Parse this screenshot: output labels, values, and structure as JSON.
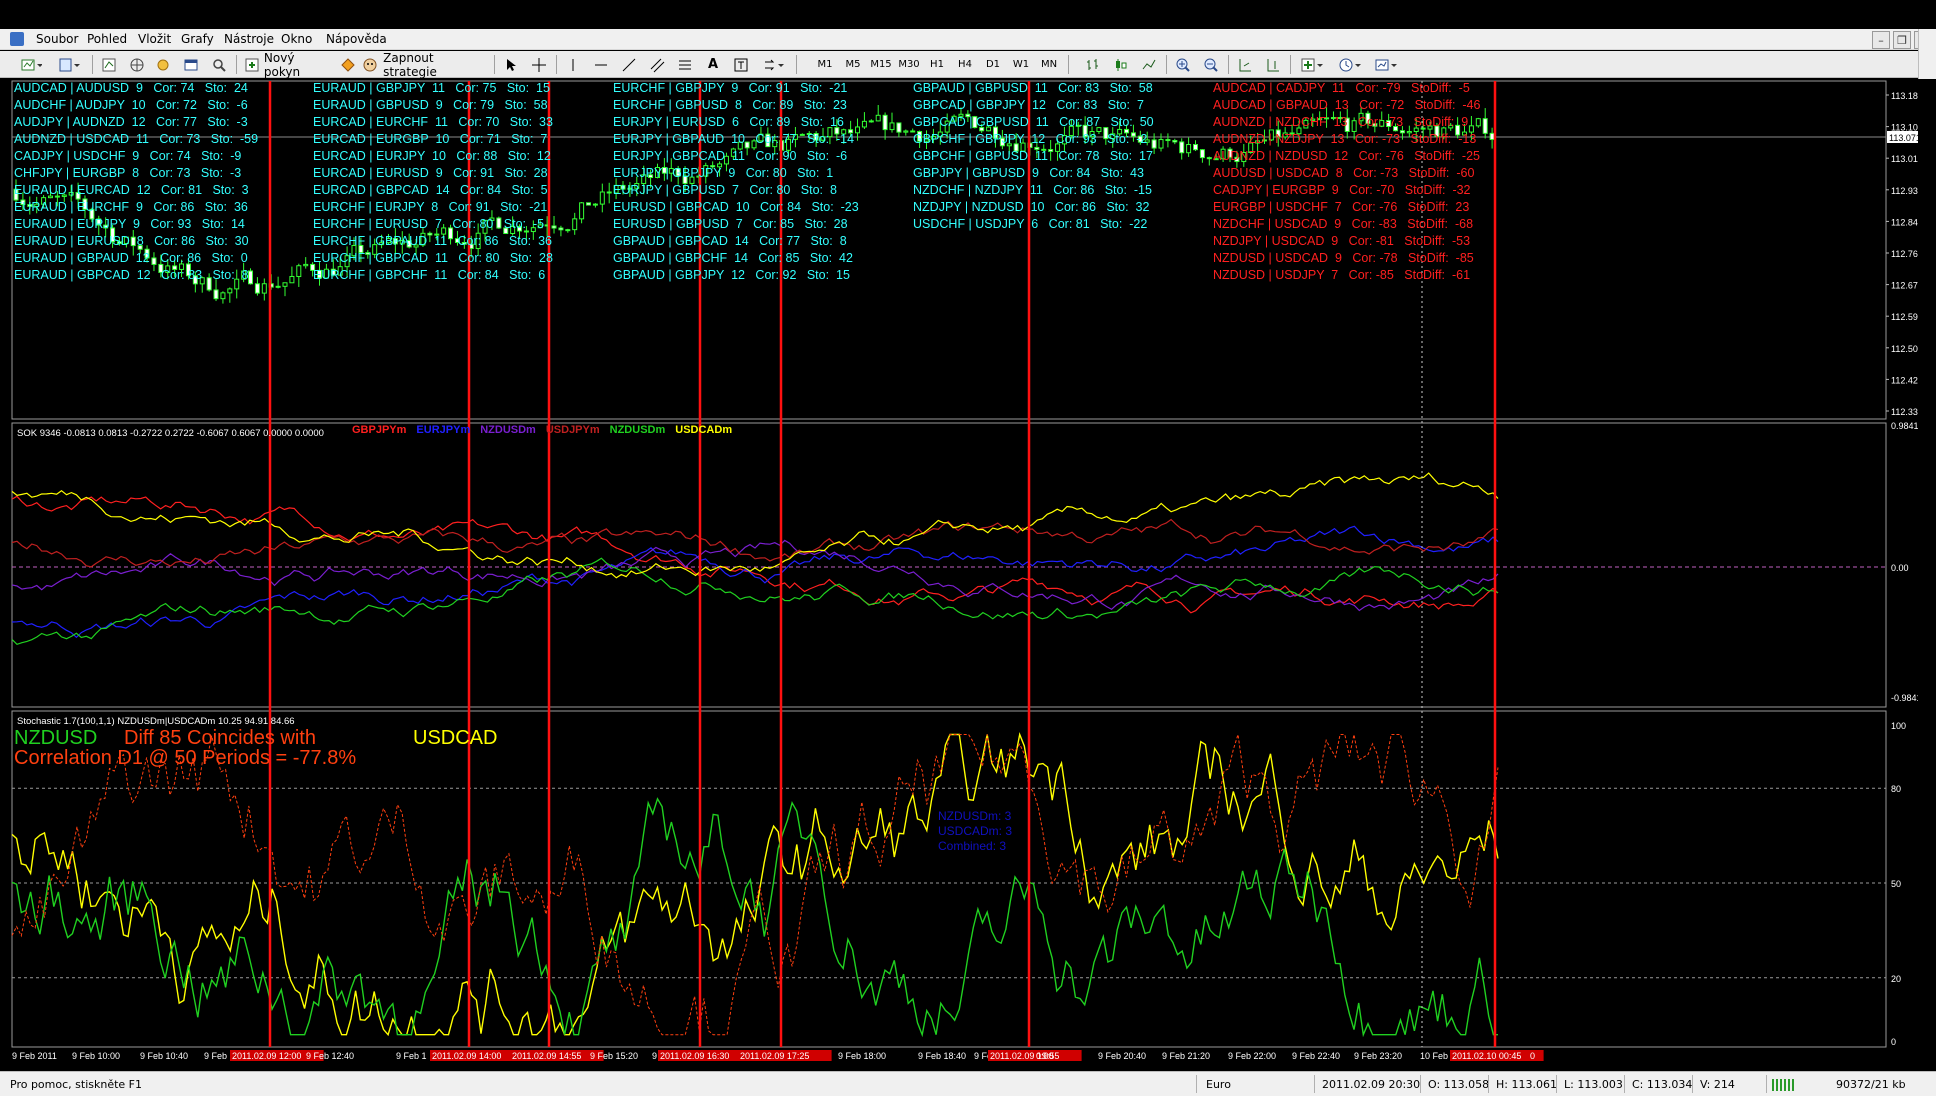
{
  "menu": [
    "Soubor",
    "Pohled",
    "Vložit",
    "Grafy",
    "Nástroje",
    "Okno",
    "Nápověda"
  ],
  "toolbar": {
    "new_order": "Nový pokyn",
    "enable_strategies": "Zapnout strategie",
    "timeframes": [
      "M1",
      "M5",
      "M15",
      "M30",
      "H1",
      "H4",
      "D1",
      "W1",
      "MN"
    ]
  },
  "window_controls": [
    "–",
    "❐",
    "✕"
  ],
  "price_axis": [
    "113.185",
    "113.100",
    "113.015",
    "112.930",
    "112.845",
    "112.760",
    "112.675",
    "112.590",
    "112.505",
    "112.420",
    "112.335"
  ],
  "current_price": "113.071",
  "osc_axis": {
    "top": "0.9841",
    "mid": "0.00",
    "bottom": "-0.9841"
  },
  "stoch_axis": [
    "100",
    "80",
    "50",
    "20",
    "0"
  ],
  "correlation_columns": [
    {
      "color": "#33ffff",
      "rows": [
        "AUDCAD | AUDUSD  9   Cor: 74   Sto:  24",
        "AUDCHF | AUDJPY  10   Cor: 72   Sto:  -6",
        "AUDJPY | AUDNZD  12   Cor: 77   Sto:  -3",
        "AUDNZD | USDCAD  11   Cor: 73   Sto:  -59",
        "CADJPY | USDCHF  9   Cor: 74   Sto:  -9",
        "CHFJPY | EURGBP  8   Cor: 73   Sto:  -3",
        "EURAUD | EURCAD  12   Cor: 81   Sto:  3",
        "EURAUD | EURCHF  9   Cor: 86   Sto:  36",
        "EURAUD | EURJPY  9   Cor: 93   Sto:  14",
        "EURAUD | EURUSD  8   Cor: 86   Sto:  30",
        "EURAUD | GBPAUD  12   Cor: 86   Sto:  0",
        "EURAUD | GBPCAD  12   Cor: 83   Sto:  8"
      ]
    },
    {
      "color": "#33ffff",
      "rows": [
        "EURAUD | GBPJPY  11   Cor: 75   Sto:  15",
        "EURAUD | GBPUSD  9   Cor: 79   Sto:  58",
        "EURCAD | EURCHF  11   Cor: 70   Sto:  33",
        "EURCAD | EURGBP  10   Cor: 71   Sto:  7",
        "EURCAD | EURJPY  10   Cor: 88   Sto:  12",
        "EURCAD | EURUSD  9   Cor: 91   Sto:  28",
        "EURCAD | GBPCAD  14   Cor: 84   Sto:  5",
        "EURCHF | EURJPY  8   Cor: 91   Sto:  -21",
        "EURCHF | EURUSD  7   Cor: 80   Sto:  -5",
        "EURCHF | GBPAUD  11   Cor: 86   Sto:  36",
        "EURCHF | GBPCAD  11   Cor: 80   Sto:  28",
        "EURCHF | GBPCHF  11   Cor: 84   Sto:  6"
      ]
    },
    {
      "color": "#33ffff",
      "rows": [
        "EURCHF | GBPJPY  9   Cor: 91   Sto:  -21",
        "EURCHF | GBPUSD  8   Cor: 89   Sto:  23",
        "EURJPY | EURUSD  6   Cor: 89   Sto:  16",
        "EURJPY | GBPAUD  10   Cor: 77   Sto:  -14",
        "EURJPY | GBPCAD  11   Cor: 90   Sto:  -6",
        "EURJPY | GBPJPY  9   Cor: 80   Sto:  1",
        "EURJPY | GBPUSD  7   Cor: 80   Sto:  8",
        "EURUSD | GBPCAD  10   Cor: 84   Sto:  -23",
        "EURUSD | GBPUSD  7   Cor: 85   Sto:  28",
        "GBPAUD | GBPCAD  14   Cor: 77   Sto:  8",
        "GBPAUD | GBPCHF  14   Cor: 85   Sto:  42",
        "GBPAUD | GBPJPY  12   Cor: 92   Sto:  15"
      ]
    },
    {
      "color": "#33ffff",
      "rows": [
        "GBPAUD | GBPUSD  11   Cor: 83   Sto:  58",
        "GBPCAD | GBPJPY  12   Cor: 83   Sto:  7",
        "GBPCAD | GBPUSD  11   Cor: 87   Sto:  50",
        "GBPCHF | GBPJPY  12   Cor: 93   Sto:  -2",
        "GBPCHF | GBPUSD  11   Cor: 78   Sto:  17",
        "GBPJPY | GBPUSD  9   Cor: 84   Sto:  43",
        "NZDCHF | NZDJPY  11   Cor: 86   Sto:  -15",
        "NZDJPY | NZDUSD  10   Cor: 86   Sto:  32",
        "USDCHF | USDJPY  6   Cor: 81   Sto:  -22"
      ]
    },
    {
      "color": "#ff2020",
      "rows": [
        "AUDCAD | CADJPY  11   Cor: -79   StoDiff:  -5",
        "AUDCAD | GBPAUD  13   Cor: -72   StoDiff:  -46",
        "AUDNZD | NZDCHF  13   Cor: -73   StoDiff:  9",
        "AUDNZD | NZDJPY  13   Cor: -73   StoDiff:  -13",
        "AUDNZD | NZDUSD  12   Cor: -76   StoDiff:  -25",
        "AUDUSD | USDCAD  8   Cor: -73   StoDiff:  -60",
        "CADJPY | EURGBP  9   Cor: -70   StoDiff:  -32",
        "EURGBP | USDCHF  7   Cor: -76   StoDiff:  23",
        "NZDCHF | USDCAD  9   Cor: -83   StoDiff:  -68",
        "NZDJPY | USDCAD  9   Cor: -81   StoDiff:  -53",
        "NZDUSD | USDCAD  9   Cor: -78   StoDiff:  -85",
        "NZDUSD | USDJPY  7   Cor: -85   StoDiff:  -61"
      ]
    }
  ],
  "osc_panel": {
    "header": "SOK 9346 -0.0813 0.0813 -0.2722 0.2722 -0.6067 0.6067 0.0000 0.0000",
    "legend": [
      {
        "label": "GBPJPYm",
        "color": "#ff2020"
      },
      {
        "label": "EURJPYm",
        "color": "#2020ff"
      },
      {
        "label": "NZDUSDm",
        "color": "#7a1fd0"
      },
      {
        "label": "USDJPYm",
        "color": "#c02020"
      },
      {
        "label": "NZDUSDm",
        "color": "#20d020"
      },
      {
        "label": "USDCADm",
        "color": "#ffff00"
      }
    ]
  },
  "stoch_panel": {
    "header": "Stochastic 1.7(100,1,1) NZDUSDm|USDCADm 10.25 94.91 84.66",
    "pair_a": "NZDUSD",
    "diff_text": "Diff 85 Coincides with",
    "corr_text": "Correlation D1 @ 50 Periods = -77.8%",
    "pair_b": "USDCAD",
    "info_lines": [
      "NZDUSDm: 3",
      "USDCADm: 3",
      "Combined: 3"
    ]
  },
  "time_axis": [
    "9 Feb 2011",
    "9 Feb 10:00",
    "9 Feb 10:40",
    "9 Feb",
    "2011.02.09 12:00",
    "9 Feb 12:40",
    "9 Feb 1",
    "2011.02.09 14:00",
    "2011.02.09 14:55",
    "9 Feb 15:20",
    "9",
    "2011.02.09 16:30",
    "2011.02.09 17:25",
    "9 Feb 18:00",
    "9 Feb 18:40",
    "9 Feb",
    "2011.02.09 19:55",
    "0:00",
    "9 Feb 20:40",
    "9 Feb 21:20",
    "9 Feb 22:00",
    "9 Feb 22:40",
    "9 Feb 23:20",
    "10 Feb",
    "2011.02.10 00:45",
    "0"
  ],
  "status": {
    "help": "Pro pomoc, stiskněte F1",
    "profile": "Euro",
    "time": "2011.02.09 20:30",
    "open": "O: 113.058",
    "high": "H: 113.061",
    "low": "L: 113.003",
    "close": "C: 113.034",
    "volume": "V: 214",
    "traffic": "90372/21 kb"
  },
  "colors": {
    "up": "#33ff33",
    "accent_red": "#ff1010",
    "grid": "#808080"
  }
}
